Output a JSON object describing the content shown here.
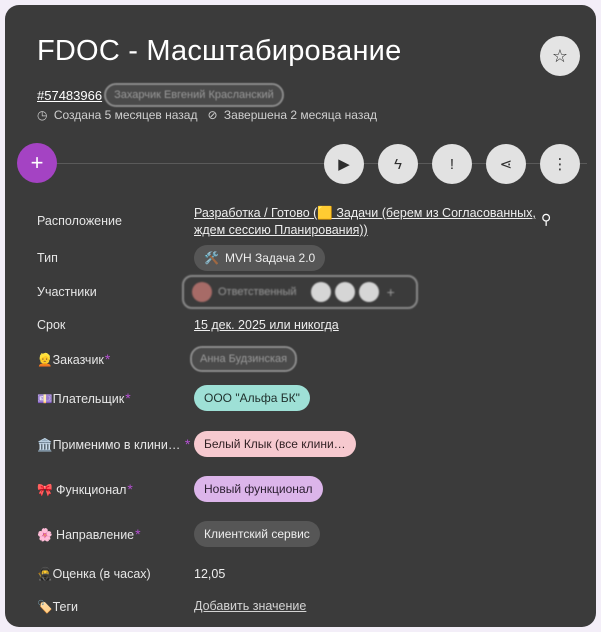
{
  "header": {
    "title": "FDOC - Масштабирование",
    "id": "#57483966",
    "author_blurred": "Захарчик Евгений Красланский",
    "created": "Создана 5 месяцев назад",
    "completed": "Завершена 2 месяца назад"
  },
  "icons": {
    "star": "star-icon",
    "add": "plus-icon",
    "play": "play-icon",
    "flash_off": "flash-auto-icon",
    "alert": "alert-icon",
    "share": "share-icon",
    "more": "more-vertical-icon"
  },
  "fields": {
    "location": {
      "label": "Расположение",
      "line1": "Разработка / Готово (🟨 Задачи (берем из Согласованных,",
      "line2": "ждем сессию Планирования))"
    },
    "type": {
      "label": "Тип",
      "icon": "🛠️",
      "value": "MVH Задача 2.0"
    },
    "participants": {
      "label": "Участники",
      "value_blurred": "Ответственный"
    },
    "deadline": {
      "label": "Срок",
      "value": "15 дек. 2025 или никогда"
    },
    "customer": {
      "label": "👱Заказчик",
      "value_blurred": "Анна Будзинская"
    },
    "payer": {
      "label": "💷Плательщик",
      "value": "ООО \"Альфа БК\""
    },
    "clinics": {
      "label": "🏛️Применимо в клини…",
      "value": "Белый Клык (все клини…"
    },
    "functional": {
      "label": "🎀 Функционал",
      "value": "Новый функционал"
    },
    "direction": {
      "label": "🌸 Направление",
      "value": "Клиентский сервис"
    },
    "estimate": {
      "label": "🥷Оценка (в часах)",
      "value": "12,05"
    },
    "tags": {
      "label": "🏷️Теги",
      "value": "Добавить значение"
    }
  },
  "required_mark": "*",
  "colors": {
    "card": "#3b3b3b",
    "accent": "#a443c3",
    "payer_chip": "#9ee0d6",
    "clinic_chip": "#f6c9cf",
    "functional_chip": "#dcb5ea",
    "direction_chip": "#565656",
    "type_chip": "#565656"
  }
}
